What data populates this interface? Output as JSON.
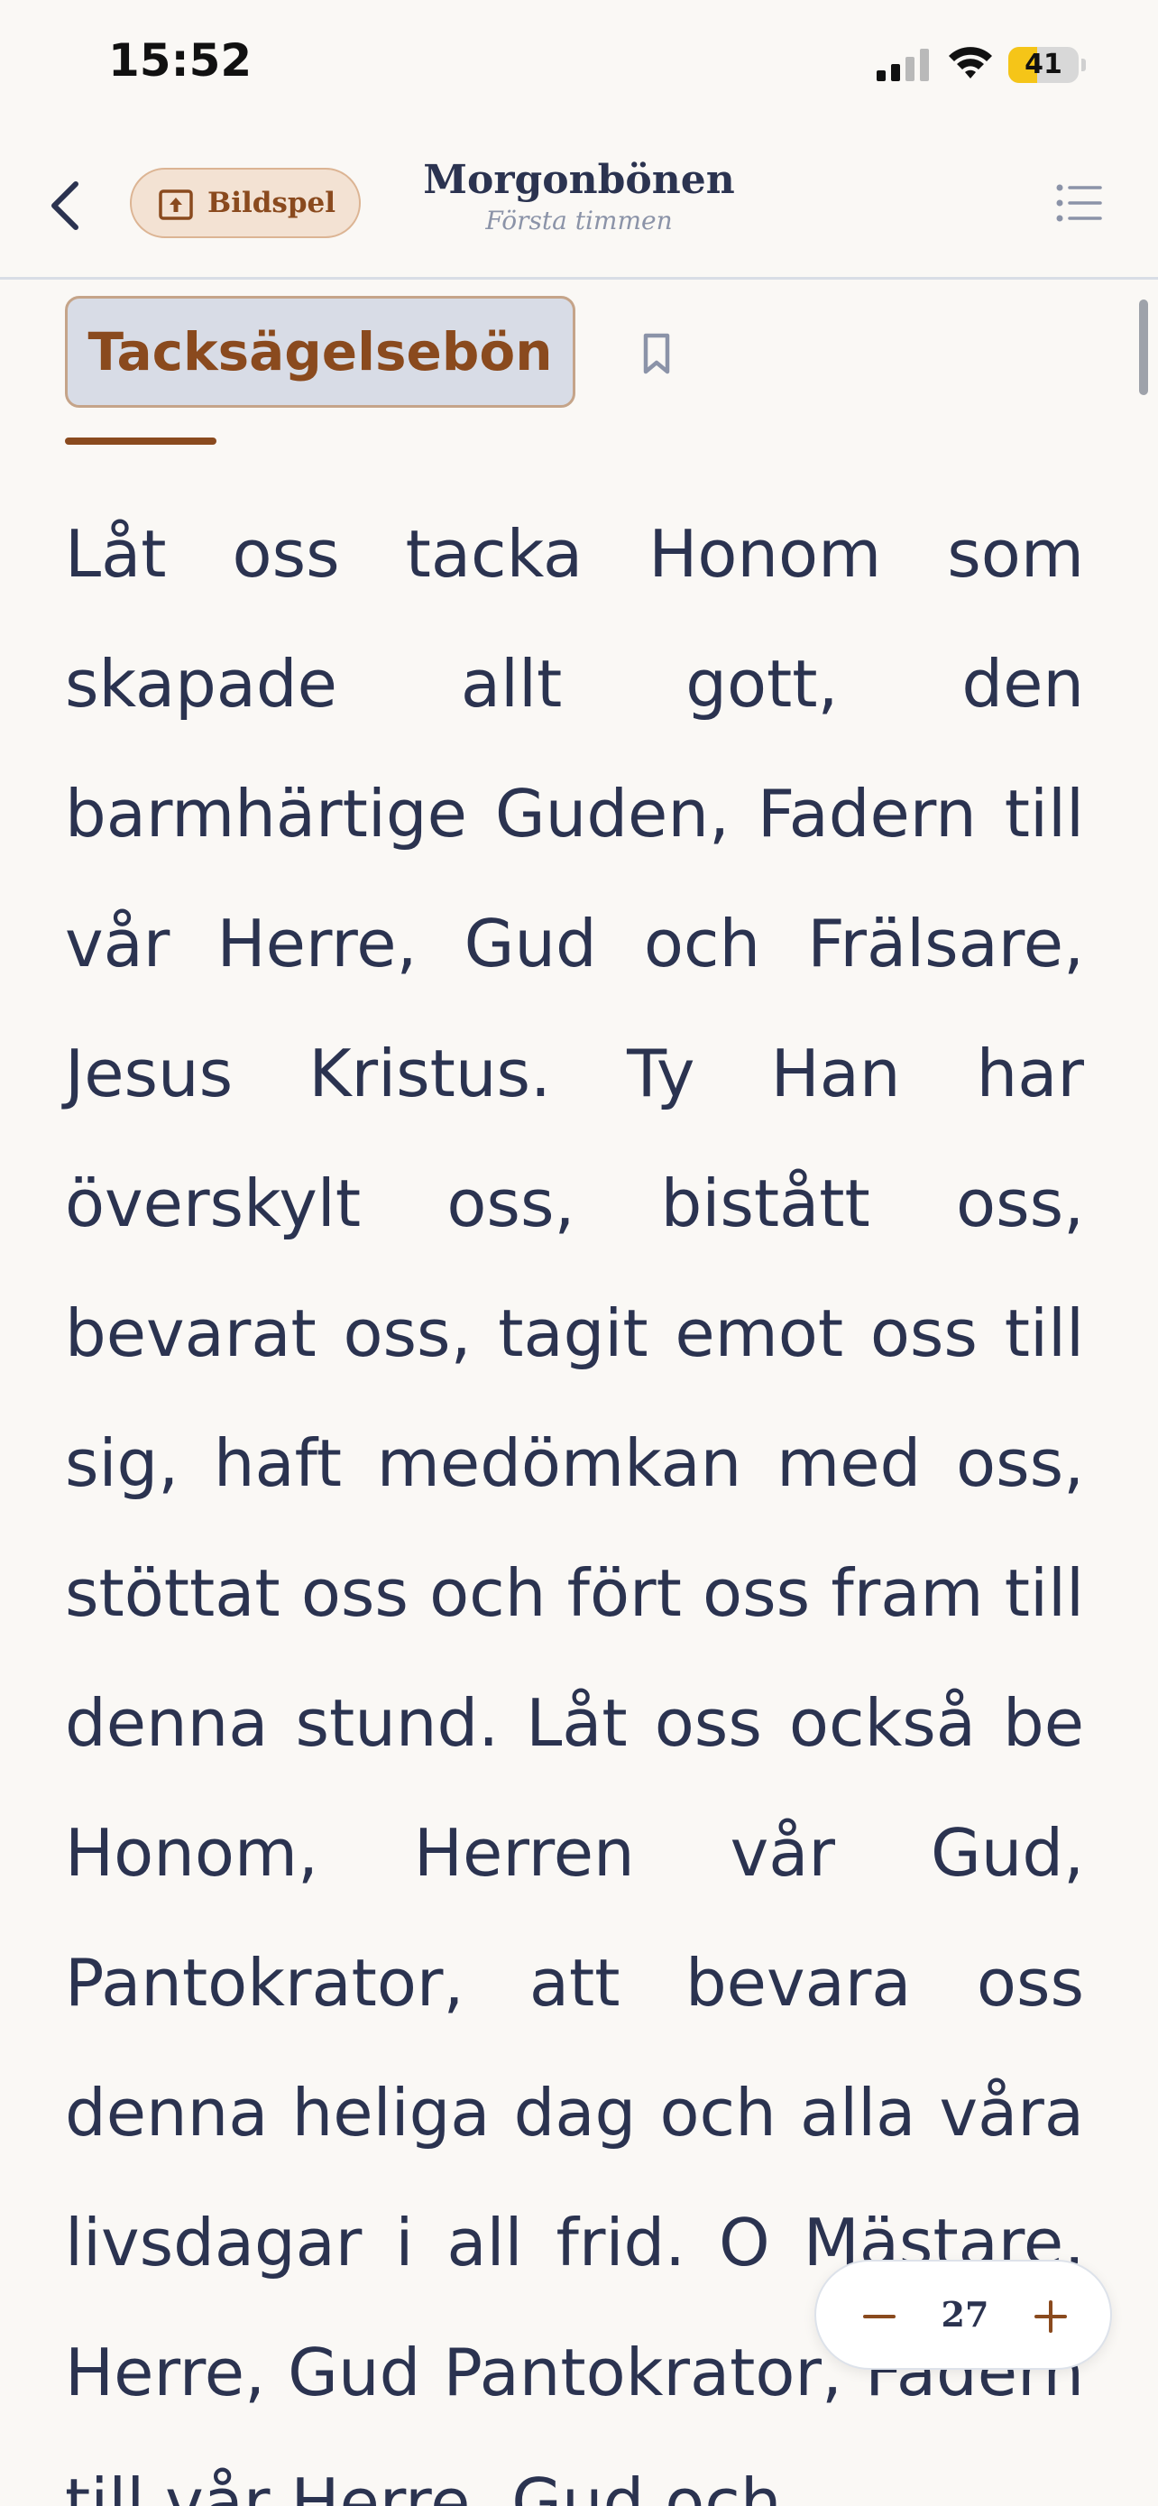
{
  "status_bar": {
    "time": "15:52",
    "battery_level": "41",
    "battery_fraction": 0.41,
    "icons": [
      "cellular-signal-icon",
      "wifi-icon",
      "battery-icon"
    ]
  },
  "nav": {
    "back_icon": "chevron-left-icon",
    "slideshow_label": "Bildspel",
    "slideshow_icon": "slideshow-upload-icon",
    "title": "Morgonbönen",
    "subtitle": "Första timmen",
    "toc_icon": "list-icon"
  },
  "section": {
    "title": "Tacksägelsebön",
    "bookmark_icon": "bookmark-icon"
  },
  "body": {
    "text": "Låt oss tacka Honom som skapade allt gott, den barmhärtige Guden, Fadern till vår Herre, Gud och Frälsare, Jesus Kristus. Ty Han har överskylt oss, bistått oss, bevarat oss, tagit emot oss till sig, haft medömkan med oss, stöttat oss och fört oss fram till denna stund. Låt oss också be Honom, Herren vår Gud, Pantokrator, att bevara oss denna heliga dag och alla våra livsdagar i all frid. O Mästare, Herre, Gud Pantokrator, Fadern till vår Herre, Gud och"
  },
  "font_size_control": {
    "minus_icon": "minus-icon",
    "value": "27",
    "plus_icon": "plus-icon"
  },
  "colors": {
    "accent_brown": "#8a4a1e",
    "text_navy": "#2b3350",
    "background": "#faf8f5",
    "chip_background": "#d8dce6",
    "battery_yellow": "#f5c518"
  }
}
